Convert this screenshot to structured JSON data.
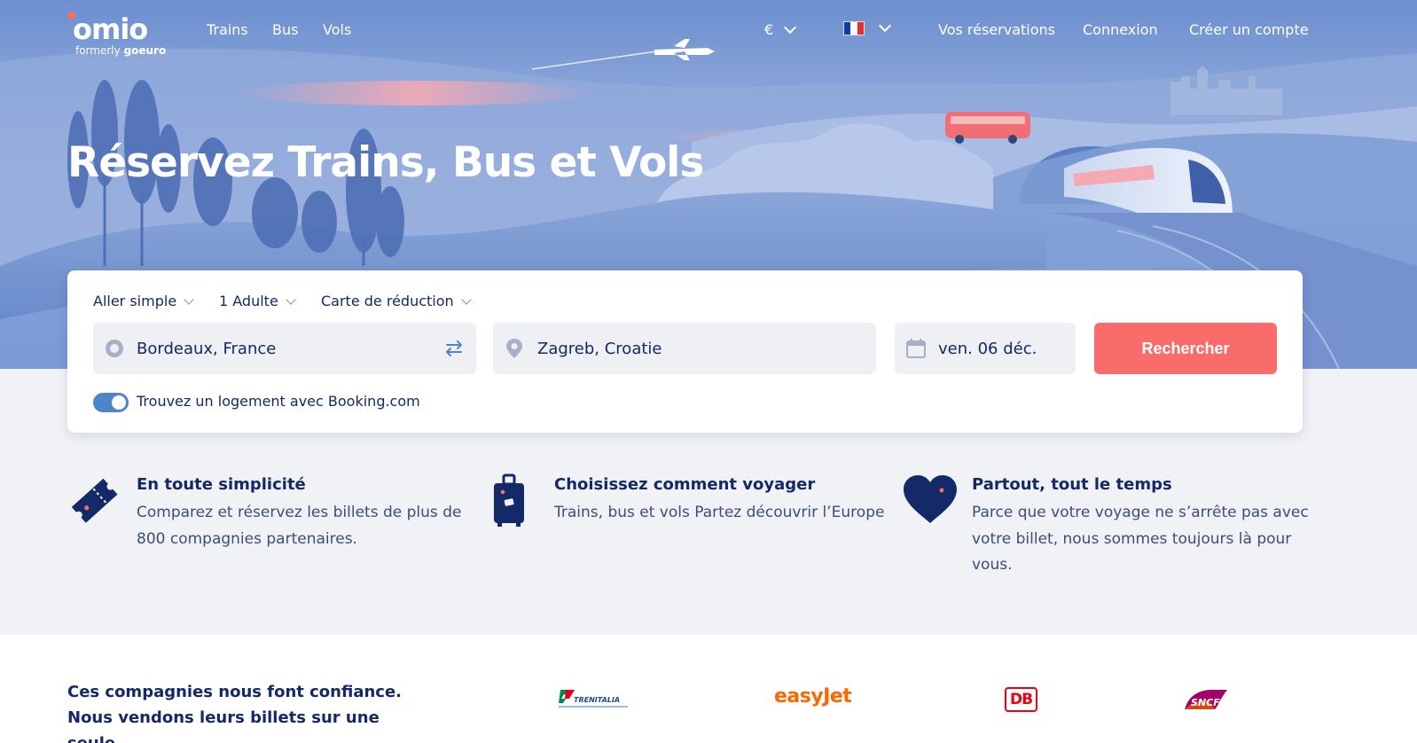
{
  "brand": {
    "name": "omio",
    "formerly": "formerly",
    "former_name": "goeuro"
  },
  "nav": {
    "links": [
      "Trains",
      "Bus",
      "Vols"
    ],
    "currency": "€",
    "language_flag": "fr-flag-icon",
    "account_links": [
      "Vos réservations",
      "Connexion",
      "Créer un compte"
    ]
  },
  "hero": {
    "title": "Réservez Trains, Bus et Vols"
  },
  "search": {
    "trip_type": "Aller simple",
    "passengers": "1 Adulte",
    "discount_card": "Carte de réduction",
    "from": "Bordeaux, France",
    "to": "Zagreb, Croatie",
    "date": "ven. 06 déc.",
    "submit_label": "Rechercher",
    "booking_toggle_on": true,
    "booking_label": "Trouvez un logement avec Booking.com"
  },
  "features": [
    {
      "icon": "ticket-icon",
      "title": "En toute simplicité",
      "text": "Comparez et réservez les billets de plus de 800 compagnies partenaires."
    },
    {
      "icon": "suitcase-icon",
      "title": "Choisissez comment voyager",
      "text": "Trains, bus et vols Partez découvrir l’Europe"
    },
    {
      "icon": "heart-icon",
      "title": "Partout, tout le temps",
      "text": "Parce que votre voyage ne s’arrête pas avec votre billet, nous sommes toujours là pour vous."
    }
  ],
  "partners": {
    "headline": "Ces compagnies nous font confiance. Nous vendons leurs billets sur une seule",
    "logos": [
      {
        "name": "trenitalia-logo",
        "label": "TRENITALIA"
      },
      {
        "name": "easyjet-logo",
        "label": "easyJet"
      },
      {
        "name": "db-logo",
        "label": "DB"
      },
      {
        "name": "sncf-logo",
        "label": "SNCF"
      }
    ]
  },
  "colors": {
    "navy": "#132968",
    "coral": "#fa6b6b",
    "toggle_blue": "#4e84c9",
    "field_bg": "#eef0f4",
    "page_bg": "#f1f2f6"
  }
}
